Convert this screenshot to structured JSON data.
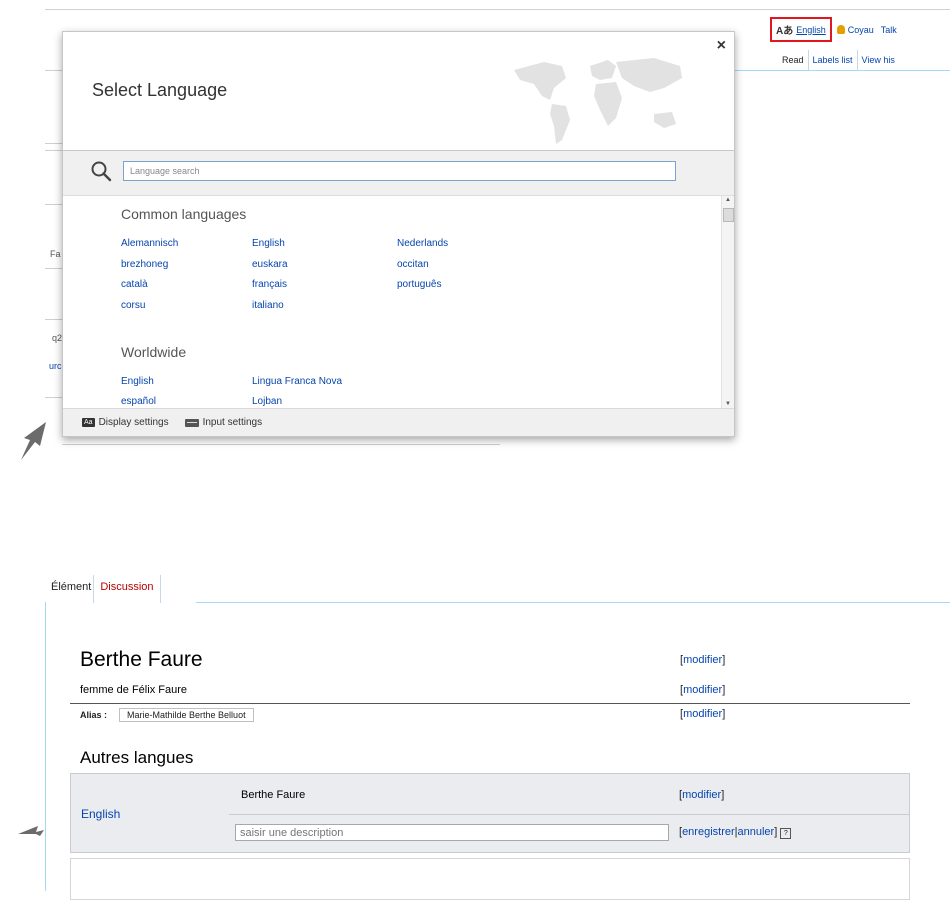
{
  "personal": {
    "uls_trigger_label": "English",
    "user": "Coyau",
    "talk": "Talk"
  },
  "view_tabs": [
    "Read",
    "Labels list",
    "View his"
  ],
  "background_fragments": {
    "fa": "Fa",
    "q2": "q2",
    "urc": "urc"
  },
  "uls": {
    "title": "Select Language",
    "close": "×",
    "search_placeholder": "Language search",
    "common_title": "Common languages",
    "common_languages": [
      [
        "Alemannisch",
        "brezhoneg",
        "català",
        "corsu"
      ],
      [
        "English",
        "euskara",
        "français",
        "italiano"
      ],
      [
        "Nederlands",
        "occitan",
        "português"
      ]
    ],
    "worldwide_title": "Worldwide",
    "worldwide_languages": [
      [
        "English",
        "español"
      ],
      [
        "Lingua Franca Nova",
        "Lojban"
      ]
    ],
    "footer": {
      "display_icon": "Aa",
      "display_settings": "Display settings",
      "input_settings": "Input settings"
    }
  },
  "item_page": {
    "tabs": [
      "Élément",
      "Discussion"
    ],
    "title": "Berthe Faure",
    "description": "femme de Félix Faure",
    "alias_label": "Alias :",
    "alias_value": "Marie-Mathilde Berthe Belluot",
    "edit_label": "modifier",
    "other_languages_title": "Autres langues",
    "lang_row": {
      "language": "English",
      "label": "Berthe Faure",
      "description_placeholder": "saisir une description",
      "save": "enregistrer",
      "cancel": "annuler",
      "help": "?"
    }
  },
  "colors": {
    "link": "#0645ad",
    "highlight_box": "#e2161e",
    "discussion_tab": "#ba0000"
  }
}
